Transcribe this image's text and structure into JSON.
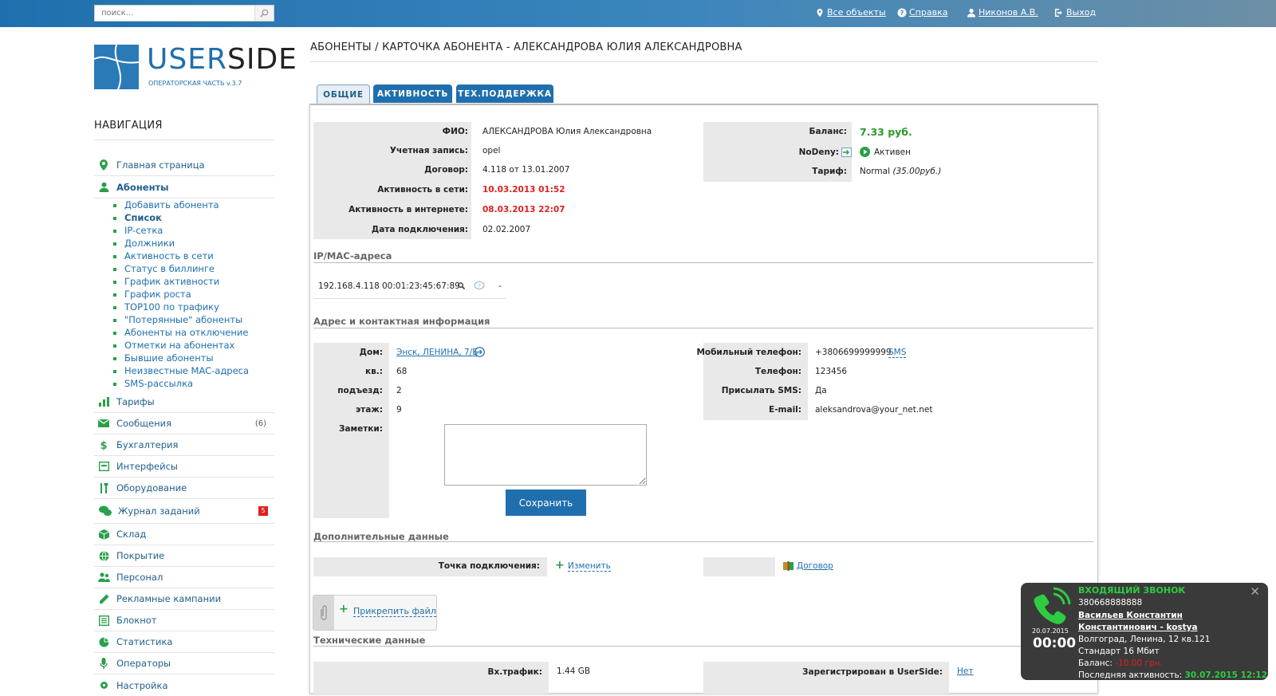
{
  "topbar": {
    "search_placeholder": "поиск...",
    "all_objects": "Все объекты",
    "help": "Справка",
    "user": "Никонов А.В.",
    "logout": "Выход"
  },
  "logo": {
    "brand_a": "USER",
    "brand_b": "SIDE",
    "subtitle": "ОПЕРАТОРСКАЯ ЧАСТЬ v.3.7"
  },
  "nav": {
    "title": "НАВИГАЦИЯ",
    "main_page": "Главная страница",
    "subscribers": "Абоненты",
    "subscribers_sub": [
      "Добавить абонента",
      "Список",
      "IP-сетка",
      "Должники",
      "Активность в сети",
      "Статус в биллинге",
      "График активности",
      "График роста",
      "TOP100 по трафику",
      "\"Потерянные\" абоненты",
      "Абоненты на отключение",
      "Отметки на абонентах",
      "Бывшие абоненты",
      "Неизвестные MAC-адреса",
      "SMS-рассылка"
    ],
    "tariffs": "Тарифы",
    "messages": "Сообщения",
    "messages_count": "(6)",
    "accounting": "Бухгалтерия",
    "interfaces": "Интерфейсы",
    "equipment": "Оборудование",
    "task_log": "Журнал заданий",
    "task_log_badge": "5",
    "warehouse": "Склад",
    "coverage": "Покрытие",
    "staff": "Персонал",
    "ad_campaigns": "Рекламные кампании",
    "notebook": "Блокнот",
    "statistics": "Статистика",
    "operators": "Операторы",
    "settings": "Настройка"
  },
  "page": {
    "title": "АБОНЕНТЫ / КАРТОЧКА АБОНЕНТА - АЛЕКСАНДРОВА ЮЛИЯ АЛЕКСАНДРОВНА",
    "tabs": [
      "ОБЩИЕ",
      "АКТИВНОСТЬ",
      "ТЕХ.ПОДДЕРЖКА"
    ]
  },
  "card": {
    "fio_label": "ФИО:",
    "fio": "АЛЕКСАНДРОВА Юлия Александровна",
    "account_label": "Учетная запись:",
    "account": "opel",
    "contract_label": "Договор:",
    "contract": "4.118 от 13.01.2007",
    "net_activity_label": "Активность в сети:",
    "net_activity": "10.03.2013 01:52",
    "inet_activity_label": "Активность в интернете:",
    "inet_activity": "08.03.2013 22:07",
    "connect_date_label": "Дата подключения:",
    "connect_date": "02.02.2007",
    "balance_label": "Баланс:",
    "balance": "7.33 руб.",
    "nodeny_label": "NoDeny:",
    "nodeny_status": "Активен",
    "tariff_label": "Тариф:",
    "tariff": "Normal",
    "tariff_price": "(35.00руб.)"
  },
  "ipmac": {
    "section": "IP/MAC-адреса",
    "ip": "192.168.4.118",
    "mac": "00:01:23:45:67:89",
    "dash": "-"
  },
  "address": {
    "section": "Адрес и контактная информация",
    "house_label": "Дом:",
    "house": "Энск, ЛЕНИНА, 7/Б",
    "flat_label": "кв.:",
    "flat": "68",
    "entrance_label": "подъезд:",
    "entrance": "2",
    "floor_label": "этаж:",
    "floor": "9",
    "notes_label": "Заметки:",
    "save": "Сохранить",
    "mobile_label": "Мобильный телефон:",
    "mobile": "+3806699999999",
    "sms": "SMS",
    "phone_label": "Телефон:",
    "phone": "123456",
    "send_sms_label": "Присылать SMS:",
    "send_sms": "Да",
    "email_label": "E-mail:",
    "email": "aleksandrova@your_net.net"
  },
  "extra": {
    "section": "Дополнительные данные",
    "point_label": "Точка подключения:",
    "change": "Изменить",
    "contract_doc": "Договор",
    "attach": "Прикрепить файл"
  },
  "tech": {
    "section": "Технические данные",
    "in_traffic_label": "Вх.трафик:",
    "in_traffic": "1.44 GB",
    "registered_label": "Зарегистрирован в UserSide:",
    "registered": "Нет"
  },
  "call": {
    "title": "ВХОДЯЩИЙ ЗВОНОК",
    "number": "380668888888",
    "name": "Васильев Константин Константинович - kostya",
    "address": "Волгоград, Ленина, 12 кв.121",
    "tariff": "Стандарт 16 Мбит",
    "balance_label": "Баланс:",
    "balance": "-10.00 грн.",
    "activity_label": "Последняя активность:",
    "activity": "30.07.2015 12:12",
    "date": "20.07.2015",
    "timer": "00:00"
  },
  "colors": {
    "accent": "#1f6fae",
    "green": "#2aa04a",
    "red": "#e02020"
  }
}
